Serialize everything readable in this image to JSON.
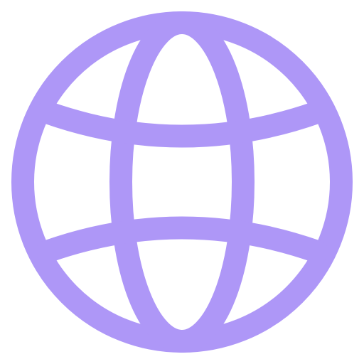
{
  "icon": {
    "name": "globe-icon",
    "color": "#ae97f7"
  }
}
